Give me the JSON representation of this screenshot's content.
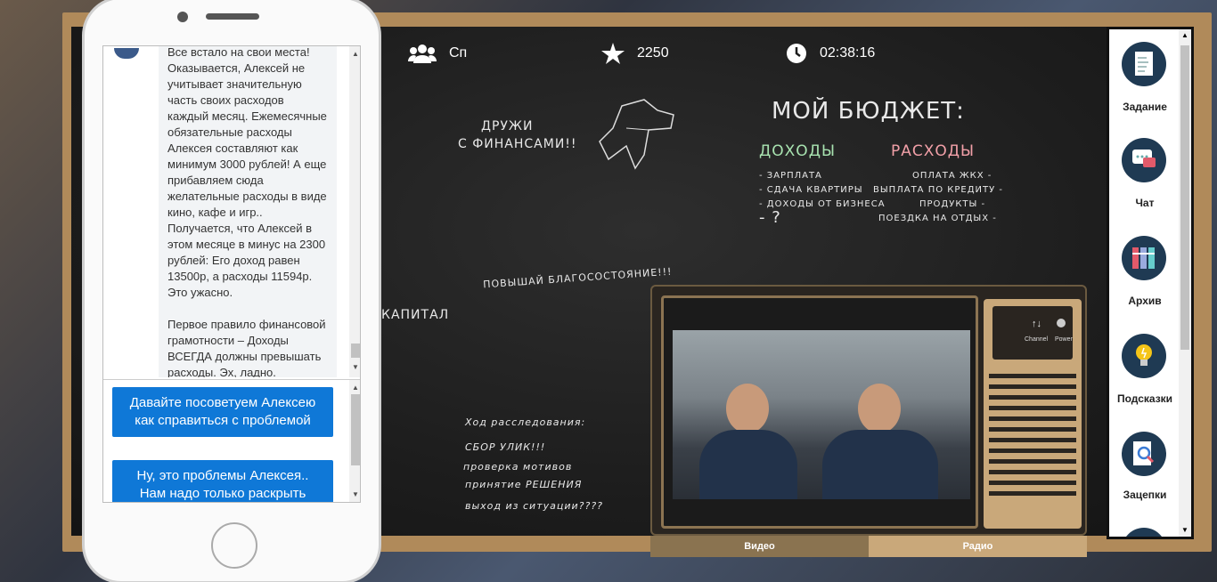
{
  "hud": {
    "team_name": "Сп",
    "score": "2250",
    "timer": "02:38:16"
  },
  "chalkboard": {
    "friends_line1": "ДРУЖИ",
    "friends_line2": "С ФИНАНСАМИ!!",
    "budget_title": "МОЙ БЮДЖЕТ:",
    "income_header": "ДОХОДЫ",
    "expenses_header": "РАСХОДЫ",
    "income_items": [
      "- ЗАРПЛАТА",
      "- СДАЧА КВАРТИРЫ",
      "- ДОХОДЫ ОТ БИЗНЕСА",
      "- ?"
    ],
    "expense_items": [
      "ОПЛАТА ЖКХ -",
      "ВЫПЛАТА ПО КРЕДИТУ -",
      "ПРОДУКТЫ -",
      "ПОЕЗДКА НА ОТДЫХ -"
    ],
    "improve": "ПОВЫШАЙ БЛАГОСОСТОЯНИЕ!!!",
    "capital": "КАПИТАЛ",
    "investigation_title": "Ход расследования:",
    "investigation_steps": [
      "СБОР УЛИК!!!",
      "проверка мотивов",
      "принятие РЕШЕНИЯ",
      "выход из ситуации????"
    ]
  },
  "chat": {
    "message": "Все встало на свои места! Оказывается, Алексей не учитывает значительную часть своих расходов каждый месяц. Ежемесячные обязательные расходы Алексея составляют как минимум 3000 рублей! А еще прибавляем сюда желательные расходы в виде кино, кафе и игр..\nПолучается, что Алексей в этом месяце в минус на 2300 рублей: Его доход равен 13500р, а расходы 11594р. Это ужасно.\n\nПервое правило финансовой грамотности – Доходы ВСЕГДА должны превышать расходы. Эх, ладно.\nНо Д",
    "answers": [
      "Давайте посоветуем Алексею как справиться с проблемой",
      "Ну, это проблемы Алексея.. Нам надо только раскрыть"
    ]
  },
  "tv": {
    "panel_channel": "Channel",
    "panel_power": "Power",
    "tabs": [
      "Видео",
      "Радио"
    ]
  },
  "sidebar": {
    "items": [
      {
        "label": "Задание",
        "icon": "task-document-icon"
      },
      {
        "label": "Чат",
        "icon": "chat-bubbles-icon"
      },
      {
        "label": "Архив",
        "icon": "archive-binders-icon"
      },
      {
        "label": "Подсказки",
        "icon": "lightbulb-icon"
      },
      {
        "label": "Зацепки",
        "icon": "magnifier-document-icon"
      }
    ]
  },
  "colors": {
    "answer_button": "#0f78d7",
    "sidebar_icon_bg": "#1f3a53",
    "frame": "#b08a5a",
    "board": "#1d1d1d"
  }
}
